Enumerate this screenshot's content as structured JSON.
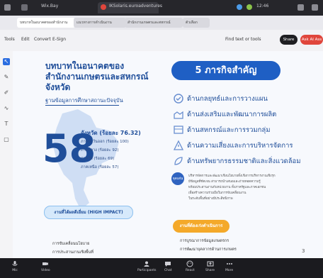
{
  "os_bar": {
    "tab1": "Wix.Bay",
    "tab2": "IKSolaris.euroadventures",
    "clock": "12:46"
  },
  "browser_tabs": [
    {
      "label": "บทบาทในอนาคตของสำนักงาน"
    },
    {
      "label": "แนวทางการดำเนินงาน"
    },
    {
      "label": "สำนักงานเกษตรและสหกรณ์"
    },
    {
      "label": "ตัวเลือก"
    }
  ],
  "toolbar": {
    "items": [
      "Tools",
      "Edit",
      "Convert",
      "E-Sign"
    ],
    "find": "Find text or tools",
    "share": "Share",
    "ask_ai": "Ask AI Ass"
  },
  "slide": {
    "title": "บทบาทในอนาคตของ สำนักงานเกษตรและสหกรณ์ จังหวัด",
    "subtitle": "ฐานข้อมูลการศึกษาสถานะปัจจุบัน",
    "big_number": "58",
    "province_label": "จังหวัด (ร้อยละ 76.32)",
    "stats": [
      "ภาคตะวันออก (ร้อยละ 100)",
      "ภาคกลาง (ร้อยละ 92)",
      "ภาคใต้ (ร้อยละ 69)",
      "ภาคเหนือ (ร้อยละ 57)"
    ],
    "impact_label": "งานที่ได้ผลดีเยี่ยม (HIGH IMPACT)",
    "left_bullets": [
      "การขับเคลื่อนนโยบาย",
      "การประสานงานเชิงพื้นที่"
    ],
    "right_title": "5 ภารกิจสำคัญ",
    "missions": [
      "ด้านกลยุทธ์และการวางแผน",
      "ด้านส่งเสริมและพัฒนาการผลิต",
      "ด้านสหกรณ์และการรวมกลุ่ม",
      "ด้านความเสี่ยงและการบริหารจัดการ",
      "ด้านทรัพยากรธรรมชาติและสิ่งแวดล้อม"
    ],
    "highlight_badge": "จุดเด่น",
    "description_lines": [
      "บริหารจัดการและพัฒนาเชิงนโยบายทั้งเชิงการบริหารงานเชิงรุก",
      "มีข้อมูลที่ชัดเจน สามารถนำเสนอและถ่ายทอดความรู้",
      "พร้อมประสานงานกับหน่วยงาน ทั้งภาครัฐและภาคเอกชน",
      "เพื่อสร้างความร่วมมือในการขับเคลื่อนงาน",
      "ในระดับพื้นที่อย่างมีประสิทธิภาพ"
    ],
    "quickwin_label": "งานที่ต้องเร่งดำเนินการ",
    "right_bullets": [
      "การบูรณาการข้อมูลเกษตรกร",
      "การพัฒนาบุคลากรด้านการเกษตร"
    ],
    "page_number": "3"
  },
  "meeting_bar": {
    "items": [
      "Mic",
      "Video",
      "Participants",
      "Chat",
      "React",
      "Share",
      "More"
    ]
  },
  "colors": {
    "accent": "#1f4e9a",
    "mission_pill": "#1f5fc4",
    "impact_pill": "#d6e9fb",
    "quickwin": "#f4a92a",
    "ask_ai": "#e0463c"
  }
}
